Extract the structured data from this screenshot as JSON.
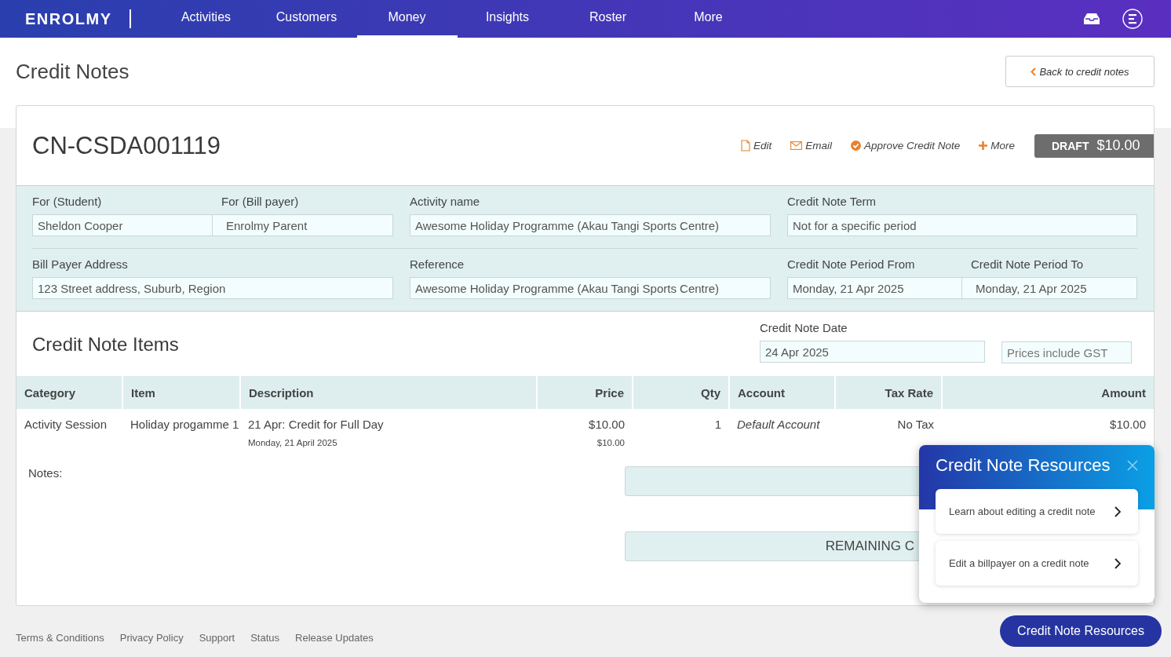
{
  "nav": {
    "logo": "ENROLMY",
    "items": [
      {
        "label": "Activities",
        "selected": false
      },
      {
        "label": "Customers",
        "selected": false
      },
      {
        "label": "Money",
        "selected": true
      },
      {
        "label": "Insights",
        "selected": false
      },
      {
        "label": "Roster",
        "selected": false
      },
      {
        "label": "More",
        "selected": false
      }
    ]
  },
  "page": {
    "title": "Credit Notes",
    "back_button": "Back to credit notes"
  },
  "credit_note": {
    "number": "CN-CSDA001119",
    "actions": [
      {
        "kind": "edit",
        "label": "Edit"
      },
      {
        "kind": "email",
        "label": "Email"
      },
      {
        "kind": "approve",
        "label": "Approve Credit Note"
      },
      {
        "kind": "more",
        "label": "More"
      }
    ],
    "status": "DRAFT",
    "total": "$10.00"
  },
  "details": [
    [
      [
        {
          "label": "For (Student)",
          "value": "Sheldon Cooper"
        },
        {
          "label": "For (Bill payer)",
          "value": "Enrolmy Parent"
        }
      ],
      [
        {
          "label": "Activity name",
          "value": "Awesome Holiday Programme (Akau Tangi Sports Centre)"
        }
      ],
      [
        {
          "label": "Credit Note Term",
          "value": "Not for a specific period"
        }
      ]
    ],
    [
      [
        {
          "label": "Bill Payer Address",
          "value": "123 Street address, Suburb, Region"
        }
      ],
      [
        {
          "label": "Reference",
          "value": "Awesome Holiday Programme (Akau Tangi Sports Centre)"
        }
      ],
      [
        {
          "label": "Credit Note Period From",
          "value": "Monday, 21 Apr 2025"
        },
        {
          "label": "Credit Note Period To",
          "value": "Monday, 21 Apr 2025"
        }
      ]
    ]
  ],
  "items": {
    "title": "Credit Note Items",
    "date_label": "Credit Note Date",
    "date_value": "24 Apr 2025",
    "gst_option": "Prices include GST",
    "table": {
      "columns": [
        {
          "label": "Category",
          "kind": "text"
        },
        {
          "label": "Item",
          "kind": "text"
        },
        {
          "label": "Description",
          "kind": "text"
        },
        {
          "label": "Price",
          "kind": "number"
        },
        {
          "label": "Qty",
          "kind": "number"
        },
        {
          "label": "Account",
          "kind": "account"
        },
        {
          "label": "Tax Rate",
          "kind": "number"
        },
        {
          "label": "Amount",
          "kind": "number"
        }
      ],
      "rows": [
        {
          "cells": [
            {
              "text": "Activity Session"
            },
            {
              "text": "Holiday progamme 1"
            },
            {
              "text": "21 Apr: Credit for Full Day",
              "sub": "Monday, 21 April 2025"
            },
            {
              "text": "$10.00",
              "sub": "$10.00"
            },
            {
              "text": "1"
            },
            {
              "text": "Default Account"
            },
            {
              "text": "No Tax"
            },
            {
              "text": "$10.00"
            }
          ]
        }
      ]
    },
    "notes_label": "Notes:",
    "summary_bars": [
      {
        "kind": "total"
      },
      {
        "kind": "remaining",
        "label": "REMAINING C"
      }
    ]
  },
  "resources": {
    "title": "Credit Note Resources",
    "links": [
      "Learn about editing a credit note",
      "Edit a billpayer on a credit note"
    ],
    "button": "Credit Note Resources"
  },
  "footer": [
    "Terms & Conditions",
    "Privacy Policy",
    "Support",
    "Status",
    "Release Updates"
  ]
}
